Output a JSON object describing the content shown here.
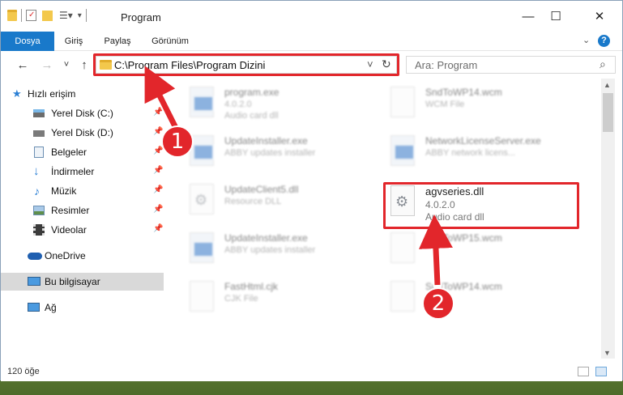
{
  "window": {
    "title": "Program"
  },
  "ribbon": {
    "tabs": [
      "Dosya",
      "Giriş",
      "Paylaş",
      "Görünüm"
    ],
    "help_label": "?"
  },
  "navigation": {
    "back": "←",
    "forward": "→",
    "recent": "˅",
    "up": "↑"
  },
  "address": {
    "path": "C:\\Program Files\\Program Dizini",
    "dropdown": "˅",
    "refresh": "↻"
  },
  "search": {
    "placeholder": "Ara: Program",
    "icon": "⌕"
  },
  "sidebar": {
    "items": [
      {
        "label": "Hızlı erişim",
        "icon": "star-icon",
        "pinned": false
      },
      {
        "label": "Yerel Disk (C:)",
        "icon": "drive-icon",
        "pinned": true
      },
      {
        "label": "Yerel Disk (D:)",
        "icon": "drive-icon",
        "pinned": true
      },
      {
        "label": "Belgeler",
        "icon": "documents-icon",
        "pinned": true
      },
      {
        "label": "İndirmeler",
        "icon": "download-icon",
        "pinned": true
      },
      {
        "label": "Müzik",
        "icon": "music-icon",
        "pinned": true
      },
      {
        "label": "Resimler",
        "icon": "pictures-icon",
        "pinned": true
      },
      {
        "label": "Videolar",
        "icon": "videos-icon",
        "pinned": true
      },
      {
        "label": "OneDrive",
        "icon": "cloud-icon",
        "pinned": false
      },
      {
        "label": "Bu bilgisayar",
        "icon": "computer-icon",
        "pinned": false,
        "selected": true
      },
      {
        "label": "Ağ",
        "icon": "network-icon",
        "pinned": false
      }
    ]
  },
  "files": [
    {
      "name": "program.exe",
      "line2": "4.0.2.0",
      "line3": "Audio card dll",
      "icon": "app-icon"
    },
    {
      "name": "SndToWP14.wcm",
      "line2": "WCM File",
      "line3": "",
      "icon": "blank-file-icon"
    },
    {
      "name": "UpdateInstaller.exe",
      "line2": "ABBY updates installer",
      "line3": "",
      "icon": "app-icon"
    },
    {
      "name": "NetworkLicenseServer.exe",
      "line2": "ABBY network licens...",
      "line3": "",
      "icon": "app-icon"
    },
    {
      "name": "UpdateClient5.dll",
      "line2": "Resource DLL",
      "line3": "",
      "icon": "dll-icon"
    },
    {
      "name": "agvseries.dll",
      "line2": "4.0.2.0",
      "line3": "Audio card dll",
      "icon": "dll-icon"
    },
    {
      "name": "UpdateInstaller.exe",
      "line2": "ABBY updates installer",
      "line3": "",
      "icon": "app-icon"
    },
    {
      "name": "SndToWP15.wcm",
      "line2": "",
      "line3": "",
      "icon": "blank-file-icon"
    },
    {
      "name": "FastHtml.cjk",
      "line2": "CJK File",
      "line3": "",
      "icon": "blank-file-icon"
    },
    {
      "name": "SndToWP14.wcm",
      "line2": "",
      "line3": "",
      "icon": "blank-file-icon"
    }
  ],
  "status": {
    "item_count": "120 öğe"
  },
  "callouts": {
    "step1": "1",
    "step2": "2"
  },
  "colors": {
    "accent": "#1979ca",
    "highlight": "#e2262b",
    "folder": "#f3c84c"
  }
}
